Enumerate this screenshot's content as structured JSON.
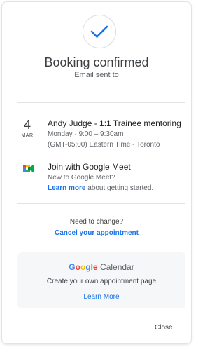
{
  "header": {
    "check_icon": "check-icon",
    "title": "Booking confirmed",
    "subtitle": "Email sent to"
  },
  "event": {
    "day": "4",
    "month": "MAR",
    "title": "Andy Judge - 1:1 Trainee mentoring",
    "time": "Monday · 9:00 – 9:30am",
    "timezone": "(GMT-05:00) Eastern Time - Toronto"
  },
  "meet": {
    "icon": "google-meet-icon",
    "title": "Join with Google Meet",
    "new_text": "New to Google Meet?",
    "learn_more": "Learn more",
    "learn_more_suffix": " about getting started."
  },
  "change": {
    "prompt": "Need to change?",
    "cancel_label": "Cancel your appointment"
  },
  "promo": {
    "brand_letters": [
      "G",
      "o",
      "o",
      "g",
      "l",
      "e"
    ],
    "brand_colors": [
      "#4285f4",
      "#ea4335",
      "#fbbc05",
      "#4285f4",
      "#34a853",
      "#ea4335"
    ],
    "brand_product": " Calendar",
    "text": "Create your own appointment page",
    "link": "Learn More"
  },
  "footer": {
    "close_label": "Close"
  },
  "colors": {
    "accent": "#1a73e8",
    "text": "#3c4043",
    "muted": "#5f6368"
  }
}
